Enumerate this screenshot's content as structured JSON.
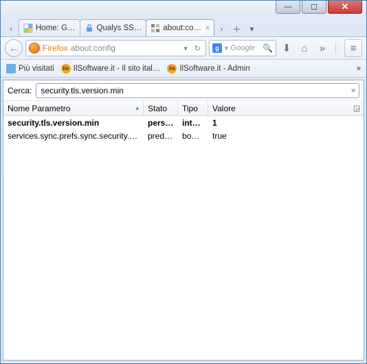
{
  "window": {
    "min": "—",
    "max": "☐",
    "close": "✕"
  },
  "tabs": {
    "prev": "‹",
    "next": "›",
    "new": "＋",
    "dd": "▾",
    "items": [
      {
        "label": "Home: G…",
        "favicon": "home"
      },
      {
        "label": "Qualys SS…",
        "favicon": "lock"
      },
      {
        "label": "about:con…",
        "favicon": "config",
        "close": "×"
      }
    ]
  },
  "nav": {
    "back": "←",
    "ff_label": "Firefox",
    "url": "about:config",
    "dd": "▾",
    "reload": "↻",
    "google_g": "g",
    "search_ph": "Google",
    "mag": "🔍",
    "download": "⬇",
    "home": "⌂",
    "more": "»",
    "menu": "≡"
  },
  "bookmarks": {
    "items": [
      {
        "label": "Più visitati",
        "icon": "blue"
      },
      {
        "label": "IlSoftware.it - Il sito ital…",
        "icon": "orange"
      },
      {
        "label": "IlSoftware.it - Admin",
        "icon": "orange"
      }
    ],
    "more": "»"
  },
  "config": {
    "search_label": "Cerca:",
    "search_value": "security.tls.version.min",
    "clear": "×",
    "columns": {
      "name": "Nome Parametro",
      "stato": "Stato",
      "tipo": "Tipo",
      "valore": "Valore",
      "sort": "▴",
      "opts": "◲"
    },
    "rows": [
      {
        "name": "security.tls.version.min",
        "stato": "perso…",
        "tipo": "intero",
        "valore": "1",
        "bold": true
      },
      {
        "name": "services.sync.prefs.sync.security.tls.ve…",
        "stato": "predef…",
        "tipo": "boole…",
        "valore": "true",
        "bold": false
      }
    ]
  }
}
